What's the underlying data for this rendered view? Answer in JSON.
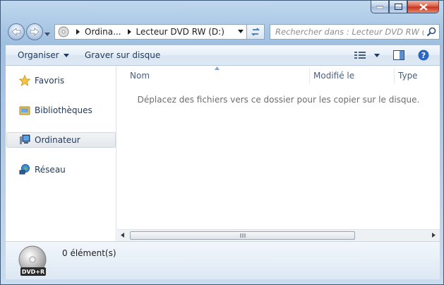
{
  "window": {
    "caption_buttons": {
      "minimize": "minimize-icon",
      "maximize": "maximize-icon",
      "close": "close-icon"
    }
  },
  "navigation": {
    "back_icon": "back-arrow-icon",
    "forward_icon": "forward-arrow-icon",
    "breadcrumb": [
      "Ordina...",
      "Lecteur DVD RW (D:)"
    ],
    "refresh_icon": "refresh-icon"
  },
  "search": {
    "placeholder": "Rechercher dans : Lecteur DVD RW (D:)"
  },
  "toolbar": {
    "organize_label": "Organiser",
    "burn_label": "Graver sur disque",
    "view_icon": "view-options-icon",
    "preview_icon": "preview-pane-icon",
    "help_icon": "help-icon"
  },
  "sidebar": {
    "items": [
      {
        "label": "Favoris",
        "icon": "star-icon"
      },
      {
        "label": "Bibliothèques",
        "icon": "libraries-icon"
      },
      {
        "label": "Ordinateur",
        "icon": "computer-icon",
        "selected": true
      },
      {
        "label": "Réseau",
        "icon": "network-icon"
      }
    ]
  },
  "file_list": {
    "columns": [
      "Nom",
      "Modifié le",
      "Type"
    ],
    "empty_message": "Déplacez des fichiers vers ce dossier pour les copier sur le disque."
  },
  "details": {
    "drive_label": "DVD+R",
    "item_count": "0 élément(s)"
  },
  "colors": {
    "accent": "#1e395b",
    "frame": "#a9c6e4",
    "selection": "#e3e7ec"
  }
}
